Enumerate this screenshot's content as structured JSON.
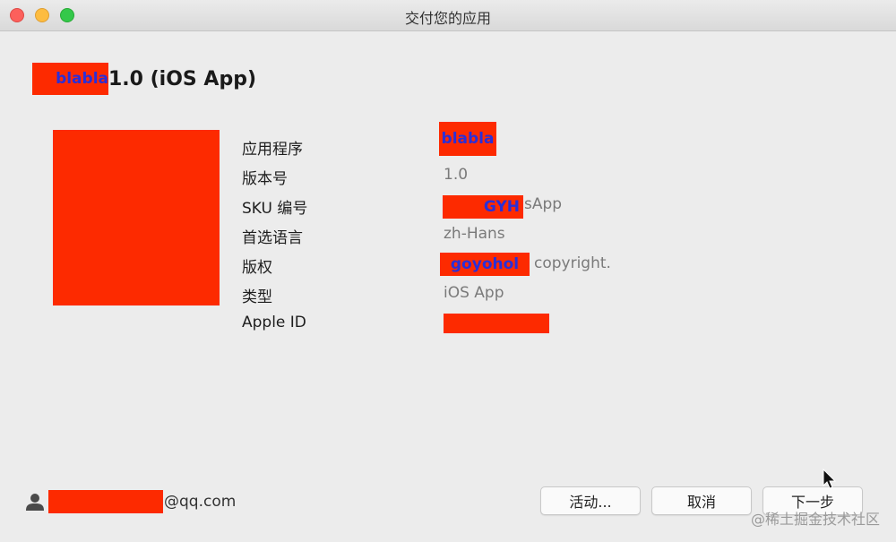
{
  "window": {
    "title": "交付您的应用"
  },
  "header": {
    "app_name": "blabla",
    "suffix": "1.0 (iOS App)"
  },
  "details": [
    {
      "label": "应用程序",
      "value": "blabla",
      "redacted": true
    },
    {
      "label": "版本号",
      "value": "1.0",
      "redacted": false
    },
    {
      "label": "SKU 编号",
      "redacted_text": "GYH",
      "value": "sApp",
      "redacted": true
    },
    {
      "label": "首选语言",
      "value": "zh-Hans",
      "redacted": false
    },
    {
      "label": "版权",
      "redacted_text": "goyohol",
      "value": "copyright.",
      "redacted": true
    },
    {
      "label": "类型",
      "value": "iOS App",
      "redacted": false
    },
    {
      "label": "Apple ID",
      "value": "",
      "redacted": true
    }
  ],
  "footer": {
    "email_suffix": "@qq.com",
    "buttons": {
      "activity": "活动...",
      "cancel": "取消",
      "next": "下一步"
    }
  },
  "watermark": "@稀土掘金技术社区",
  "colors": {
    "redaction": "#fd2a00",
    "redaction_text": "#2a2fd8"
  }
}
